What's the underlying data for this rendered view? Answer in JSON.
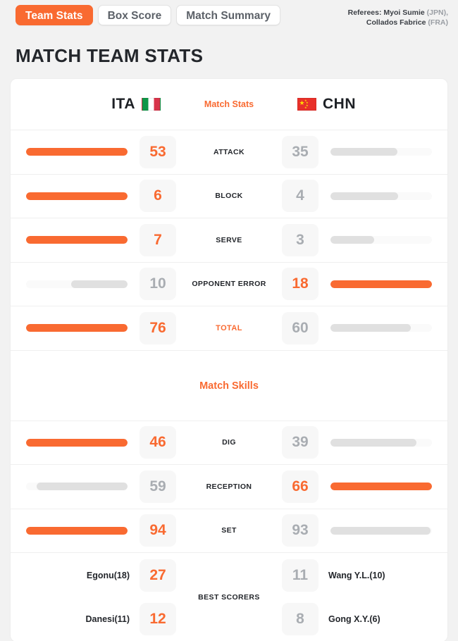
{
  "tabs": [
    {
      "label": "Team Stats",
      "active": true
    },
    {
      "label": "Box Score",
      "active": false
    },
    {
      "label": "Match Summary",
      "active": false
    }
  ],
  "referees": {
    "line1_prefix": "Referees: Myoi Sumie",
    "line1_country": "(JPN),",
    "line2_prefix": "Collados Fabrice",
    "line2_country": "(FRA)"
  },
  "page_title": "MATCH TEAM STATS",
  "teams": {
    "home": {
      "code": "ITA",
      "flag": "italy-flag"
    },
    "away": {
      "code": "CHN",
      "flag": "china-flag"
    },
    "center_label": "Match Stats"
  },
  "skills_title": "Match Skills",
  "colors": {
    "accent": "#f96a31",
    "bar_win": "#f96a31",
    "bar_lose": "#e0e0e0",
    "bar_track": "#fafafa",
    "value_lose": "#a9adb2"
  },
  "chart_data": {
    "type": "bar",
    "title": "MATCH TEAM STATS",
    "orientation": "horizontal-diverging",
    "categories": [
      "ATTACK",
      "BLOCK",
      "SERVE",
      "OPPONENT ERROR",
      "TOTAL",
      "DIG",
      "RECEPTION",
      "SET"
    ],
    "series": [
      {
        "name": "ITA",
        "values": [
          53,
          6,
          7,
          10,
          76,
          46,
          59,
          94
        ]
      },
      {
        "name": "CHN",
        "values": [
          35,
          4,
          3,
          18,
          60,
          39,
          66,
          93
        ]
      }
    ],
    "legend": [
      "ITA",
      "CHN"
    ],
    "grid": false
  },
  "stats": [
    {
      "label": "ATTACK",
      "accent": false,
      "home": "53",
      "away": "35",
      "home_pct": 100,
      "away_pct": 66.0,
      "home_win": true,
      "away_win": false
    },
    {
      "label": "BLOCK",
      "accent": false,
      "home": "6",
      "away": "4",
      "home_pct": 100,
      "away_pct": 66.7,
      "home_win": true,
      "away_win": false
    },
    {
      "label": "SERVE",
      "accent": false,
      "home": "7",
      "away": "3",
      "home_pct": 100,
      "away_pct": 42.9,
      "home_win": true,
      "away_win": false
    },
    {
      "label": "OPPONENT ERROR",
      "accent": false,
      "home": "10",
      "away": "18",
      "home_pct": 55.6,
      "away_pct": 100,
      "home_win": false,
      "away_win": true
    },
    {
      "label": "TOTAL",
      "accent": true,
      "home": "76",
      "away": "60",
      "home_pct": 100,
      "away_pct": 78.9,
      "home_win": true,
      "away_win": false
    }
  ],
  "skills": [
    {
      "label": "DIG",
      "accent": false,
      "home": "46",
      "away": "39",
      "home_pct": 100,
      "away_pct": 84.8,
      "home_win": true,
      "away_win": false
    },
    {
      "label": "RECEPTION",
      "accent": false,
      "home": "59",
      "away": "66",
      "home_pct": 89.4,
      "away_pct": 100,
      "home_win": false,
      "away_win": true
    },
    {
      "label": "SET",
      "accent": false,
      "home": "94",
      "away": "93",
      "home_pct": 100,
      "away_pct": 98.9,
      "home_win": true,
      "away_win": false
    }
  ],
  "best_scorers": {
    "label": "BEST SCORERS",
    "home": [
      {
        "name": "Egonu(18)",
        "value": "27"
      },
      {
        "name": "Danesi(11)",
        "value": "12"
      }
    ],
    "away": [
      {
        "name": "Wang Y.L.(10)",
        "value": "11"
      },
      {
        "name": "Gong X.Y.(6)",
        "value": "8"
      }
    ]
  }
}
